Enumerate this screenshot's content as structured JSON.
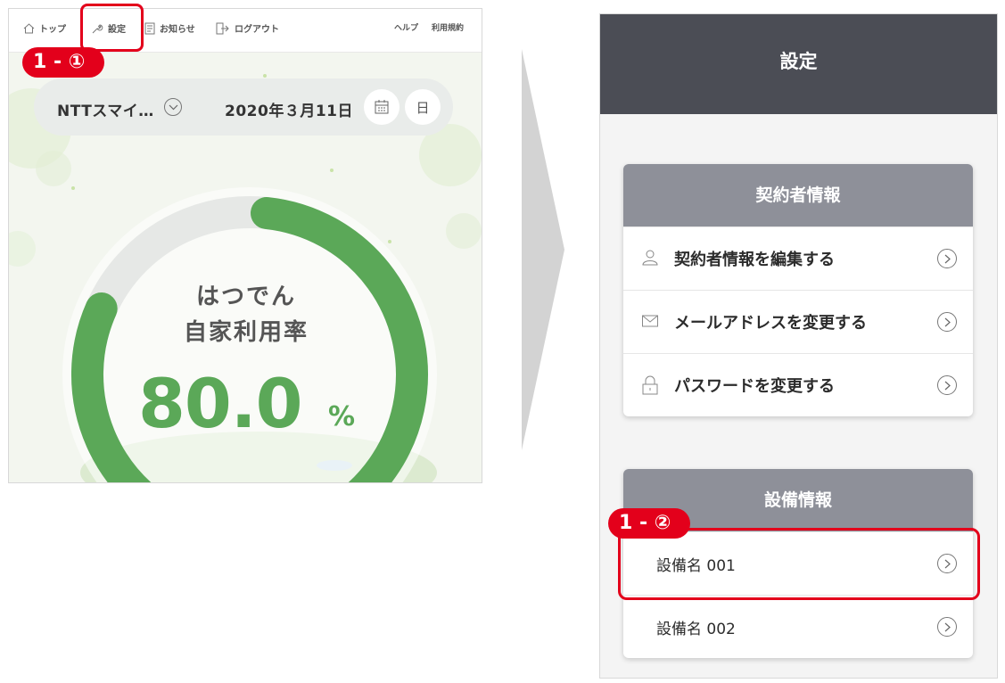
{
  "left_panel": {
    "nav": {
      "top": "トップ",
      "settings": "設定",
      "notices": "お知らせ",
      "logout": "ログアウト",
      "help": "ヘルプ",
      "terms": "利用規約"
    },
    "selector": {
      "name": "NTTスマイ…",
      "date": "2020年３月11日",
      "day_button": "日"
    },
    "gauge": {
      "title_line1": "はつでん",
      "title_line2": "自家利用率",
      "value": "80.0",
      "unit": "%",
      "percent": 80.0,
      "color": "#5ba858"
    },
    "badge": "1 - ①"
  },
  "right_panel": {
    "header_title": "設定",
    "contract_section": {
      "title": "契約者情報",
      "items": [
        {
          "label": "契約者情報を編集する",
          "icon": "person-icon"
        },
        {
          "label": "メールアドレスを変更する",
          "icon": "mail-icon"
        },
        {
          "label": "パスワードを変更する",
          "icon": "lock-icon"
        }
      ]
    },
    "equipment_section": {
      "title": "設備情報",
      "items": [
        {
          "label": "設備名 001"
        },
        {
          "label": "設備名 002"
        }
      ]
    },
    "badge": "1 - ②"
  },
  "colors": {
    "highlight": "#e3001b",
    "header_bg": "#4b4d55",
    "section_head_bg": "#8e9099",
    "gauge_green": "#5ba858"
  }
}
